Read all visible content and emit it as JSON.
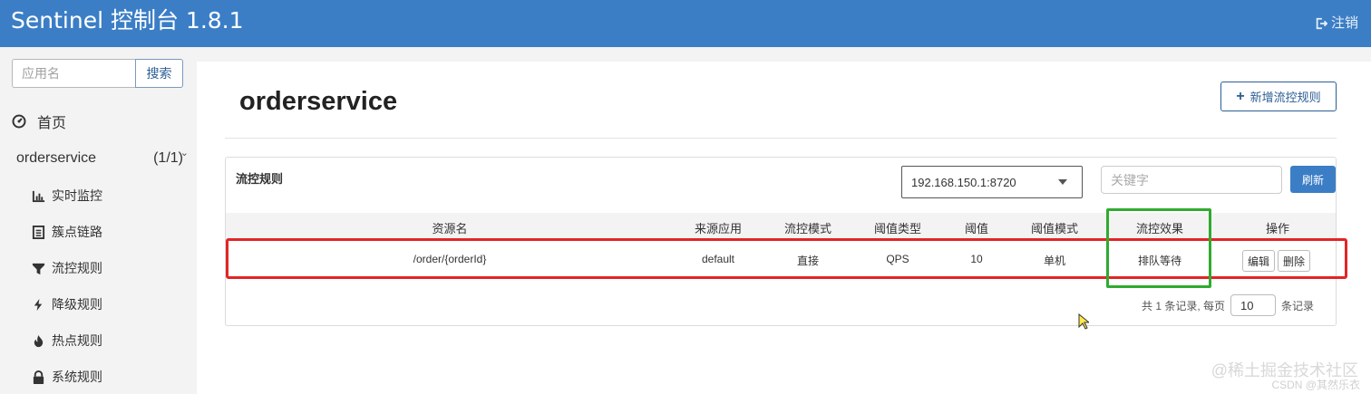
{
  "header": {
    "title": "Sentinel 控制台 1.8.1",
    "logout_label": "注销"
  },
  "sidebar": {
    "search_placeholder": "应用名",
    "search_button": "搜索",
    "home_label": "首页",
    "app": {
      "name": "orderservice",
      "count": "(1/1)"
    },
    "items": [
      {
        "label": "实时监控",
        "icon": "bar-chart-icon"
      },
      {
        "label": "簇点链路",
        "icon": "list-icon"
      },
      {
        "label": "流控规则",
        "icon": "filter-icon"
      },
      {
        "label": "降级规则",
        "icon": "bolt-icon"
      },
      {
        "label": "热点规则",
        "icon": "fire-icon"
      },
      {
        "label": "系统规则",
        "icon": "lock-icon"
      }
    ]
  },
  "main": {
    "page_title": "orderservice",
    "add_button": "新增流控规则",
    "panel": {
      "title": "流控规则",
      "machine_select": "192.168.150.1:8720",
      "keyword_placeholder": "关键字",
      "refresh_button": "刷新",
      "columns": [
        "资源名",
        "来源应用",
        "流控模式",
        "阈值类型",
        "阈值",
        "阈值模式",
        "流控效果",
        "操作"
      ],
      "rows": [
        {
          "resource": "/order/{orderId}",
          "origin": "default",
          "mode": "直接",
          "threshold_type": "QPS",
          "threshold": "10",
          "cluster_mode": "单机",
          "effect": "排队等待",
          "edit": "编辑",
          "delete": "删除"
        }
      ],
      "pagination": {
        "prefix": "共 1 条记录, 每页",
        "page_size": "10",
        "suffix": "条记录"
      }
    }
  },
  "watermark": {
    "line1": "@稀土掘金技术社区",
    "line2": "CSDN @其然乐衣"
  },
  "colors": {
    "header": "#3b7ec6",
    "highlight_red": "#e22525",
    "highlight_green": "#2fab2f"
  }
}
